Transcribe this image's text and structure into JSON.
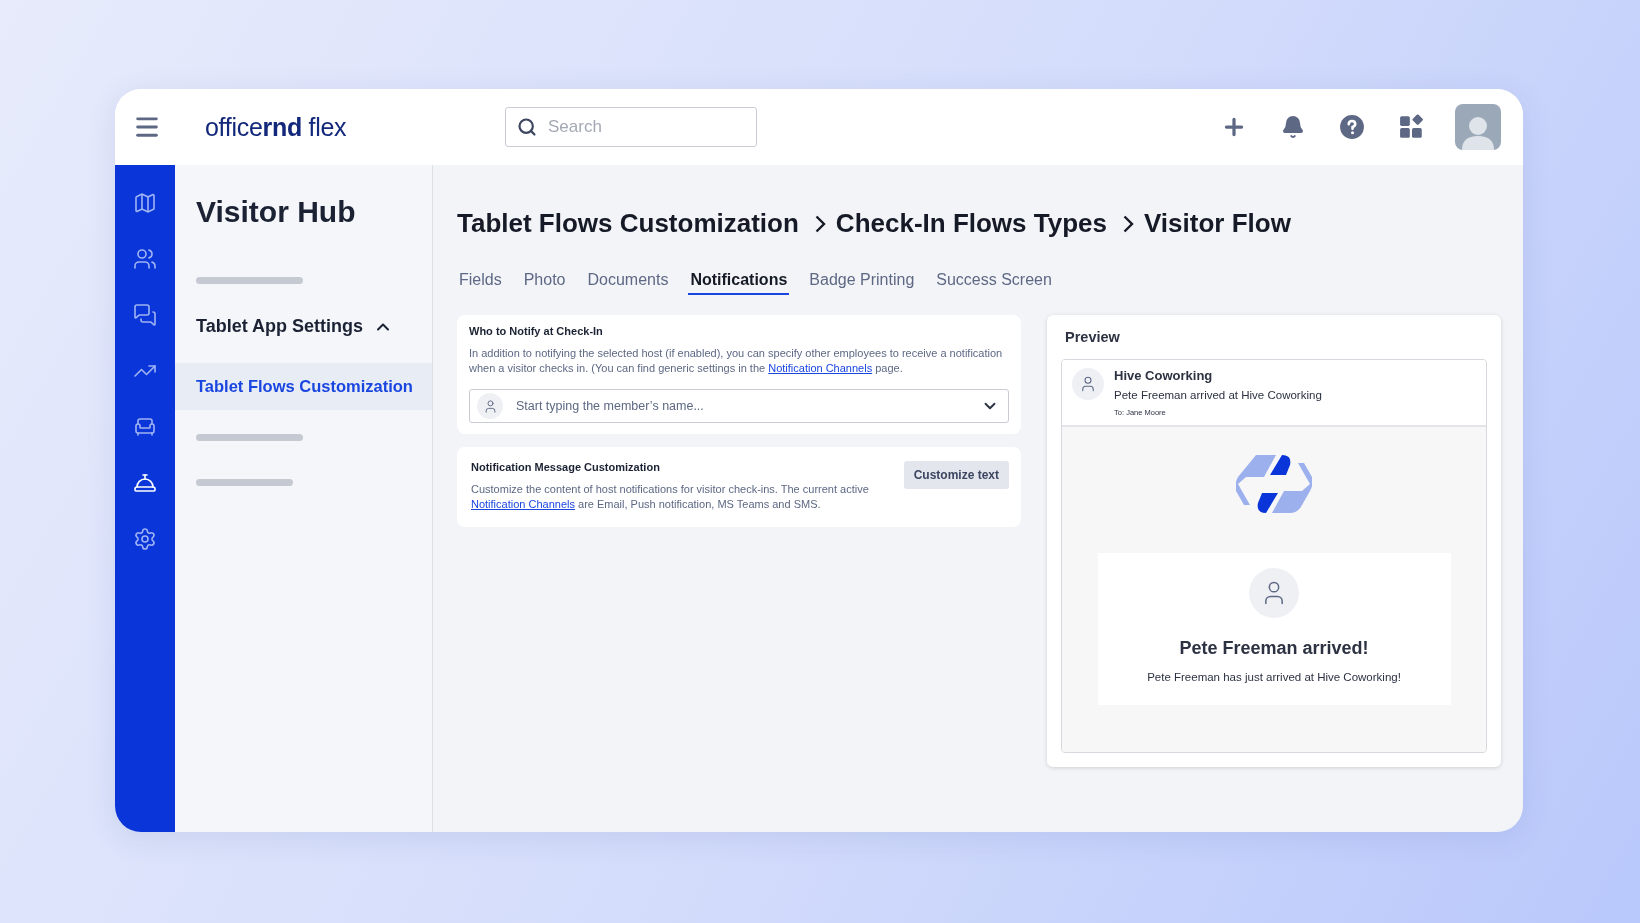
{
  "topbar": {
    "logo": "office**rnd** flex",
    "search": {
      "placeholder": "Search"
    }
  },
  "rail": [
    {
      "kind": "map",
      "selected": false
    },
    {
      "kind": "people",
      "selected": false
    },
    {
      "kind": "chat",
      "selected": false
    },
    {
      "kind": "chart",
      "selected": false
    },
    {
      "kind": "desk",
      "selected": false
    },
    {
      "kind": "concierge",
      "selected": true
    },
    {
      "kind": "settings",
      "selected": false
    }
  ],
  "sidebar": {
    "title": "Visitor Hub",
    "items": [
      {
        "kind": "skeleton"
      },
      {
        "kind": "group",
        "label": "Tablet App Settings",
        "expanded": true
      },
      {
        "kind": "link",
        "label": "Tablet Flows Customization",
        "selected": true
      },
      {
        "kind": "skeleton"
      },
      {
        "kind": "skeleton"
      }
    ]
  },
  "breadcrumb": [
    "Tablet Flows Customization",
    "Check-In Flows Types",
    "Visitor Flow"
  ],
  "tabs": [
    {
      "label": "Fields",
      "selected": false
    },
    {
      "label": "Photo",
      "selected": false
    },
    {
      "label": "Documents",
      "selected": false
    },
    {
      "label": "Notifications",
      "selected": true
    },
    {
      "label": "Badge Printing",
      "selected": false
    },
    {
      "label": "Success Screen",
      "selected": false
    }
  ],
  "notify_card": {
    "title": "Who to Notify at Check-In",
    "text_before": "In addition to notifying the selected host (if enabled), you can specify other employees to receive a notification when a visitor checks in. (You can find generic settings in the ",
    "link": "Notification Channels",
    "text_after": " page.",
    "member_field": {
      "placeholder": "Start typing the member’s name..."
    }
  },
  "message_card": {
    "title": "Notification Message Customization",
    "text_before": "Customize the content of host notifications for visitor check-ins. The current active ",
    "link": "Notification Channels",
    "text_after": " are Email, Push notification, MS Teams and SMS.",
    "button": "Customize text"
  },
  "preview": {
    "title": "Preview",
    "notification": {
      "sender": "Hive Coworking",
      "message": "Pete Freeman arrived at Hive Coworking",
      "recipient": "To: Jane Moore"
    },
    "screen": {
      "heading": "Pete Freeman arrived!",
      "text": "Pete Freeman has just arrived at Hive Coworking!"
    }
  }
}
